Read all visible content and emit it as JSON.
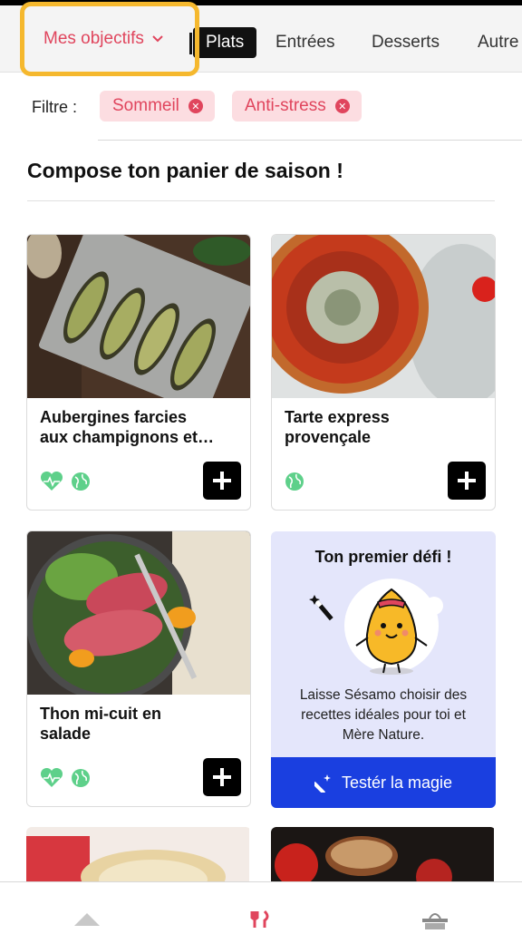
{
  "tabs": {
    "objectives_label": "Mes objectifs",
    "items": [
      "Plats",
      "Entrées",
      "Desserts",
      "Autre"
    ]
  },
  "filter": {
    "label": "Filtre :",
    "chips": [
      "Sommeil",
      "Anti-stress"
    ]
  },
  "section_title": "Compose ton panier de saison !",
  "recipes": [
    {
      "title_line1": "Aubergines farcies",
      "title_line2": "aux champignons et…",
      "icons": [
        "heart-icon",
        "globe-icon"
      ]
    },
    {
      "title_line1": "Tarte express",
      "title_line2": "provençale",
      "icons": [
        "globe-icon"
      ]
    },
    {
      "title_line1": "Thon mi-cuit en",
      "title_line2": "salade",
      "icons": [
        "heart-icon",
        "globe-icon"
      ]
    }
  ],
  "promo": {
    "title": "Ton premier défi !",
    "text_line1": "Laisse Sésamo choisir des",
    "text_line2": "recettes idéales pour toi et",
    "text_line3": "Mère Nature.",
    "button_label": "Testér la magie"
  },
  "colors": {
    "accent_pink": "#e0455d",
    "highlight_orange": "#f5b82e",
    "promo_blue": "#1a3fe0",
    "icon_green": "#5ed08a"
  },
  "bottom_nav": [
    "home-icon",
    "recipes-icon",
    "basket-icon"
  ]
}
